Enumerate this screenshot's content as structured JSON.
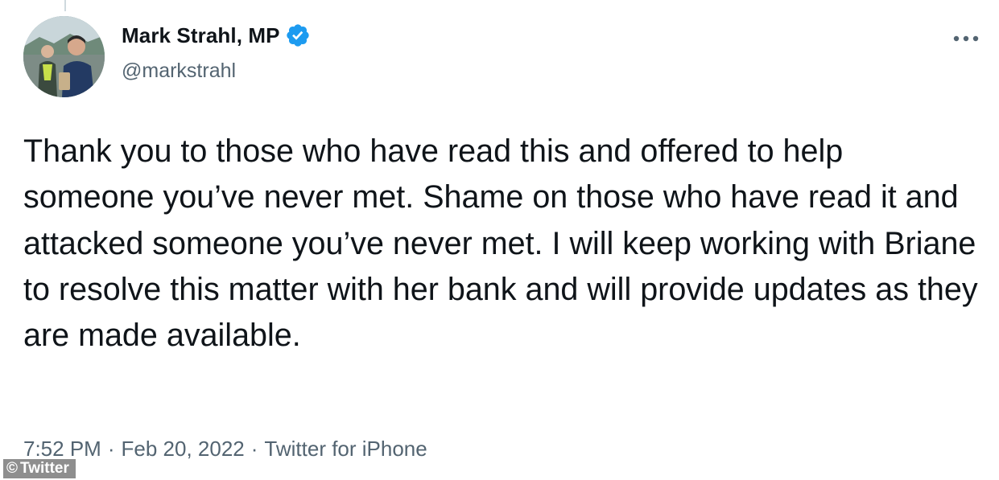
{
  "author": {
    "display_name": "Mark Strahl, MP",
    "handle": "@markstrahl",
    "verified": true,
    "avatar_icon": "profile-photo"
  },
  "tweet": {
    "text": "Thank you to those who have read this and offered to help someone you’ve never met. Shame on those who have read it and attacked someone you’ve never met. I will keep working with Briane to resolve this matter with her bank and will provide updates as they are made available."
  },
  "meta": {
    "time": "7:52 PM",
    "separator": "·",
    "date": "Feb 20, 2022",
    "source": "Twitter for iPhone"
  },
  "watermark": {
    "symbol": "©",
    "text": "Twitter"
  },
  "colors": {
    "verified_blue": "#1d9bf0",
    "text_primary": "#0f1419",
    "text_secondary": "#536471"
  },
  "icons": {
    "more": "more-horizontal-icon",
    "verified": "verified-badge-icon"
  }
}
